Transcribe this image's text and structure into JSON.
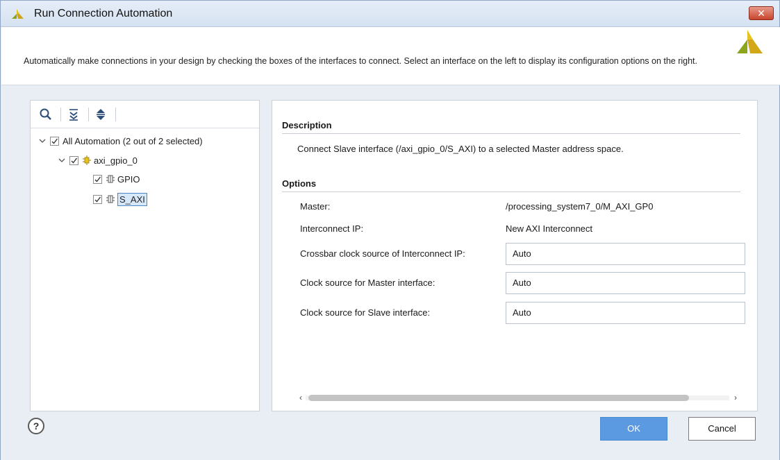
{
  "window": {
    "title": "Run Connection Automation",
    "close_label": "✕"
  },
  "header": {
    "description": "Automatically make connections in your design by checking the boxes of the interfaces to connect. Select an interface on the left to display its configuration options on the right."
  },
  "toolbar": {
    "icons": [
      "search-icon",
      "collapse-all-icon",
      "expand-all-icon"
    ]
  },
  "tree": {
    "root": {
      "label": "All Automation (2 out of 2 selected)",
      "checked": true
    },
    "ip": {
      "label": "axi_gpio_0",
      "checked": true
    },
    "interfaces": [
      {
        "label": "GPIO",
        "checked": true,
        "selected": false
      },
      {
        "label": "S_AXI",
        "checked": true,
        "selected": true
      }
    ]
  },
  "details": {
    "description_title": "Description",
    "description_text": "Connect Slave interface (/axi_gpio_0/S_AXI) to a selected Master address space.",
    "options_title": "Options",
    "options": {
      "master_label": "Master:",
      "master_value": "/processing_system7_0/M_AXI_GP0",
      "interconnect_label": "Interconnect IP:",
      "interconnect_value": "New AXI Interconnect",
      "crossbar_label": "Crossbar clock source of Interconnect IP:",
      "crossbar_value": "Auto",
      "master_clock_label": "Clock source for Master interface:",
      "master_clock_value": "Auto",
      "slave_clock_label": "Clock source for Slave interface:",
      "slave_clock_value": "Auto"
    },
    "scroll_left": "‹",
    "scroll_right": "›"
  },
  "footer": {
    "help_label": "?",
    "ok_label": "OK",
    "cancel_label": "Cancel"
  },
  "colors": {
    "accent": "#5b9ae0",
    "xilinx_logo": "#d7b81a"
  }
}
